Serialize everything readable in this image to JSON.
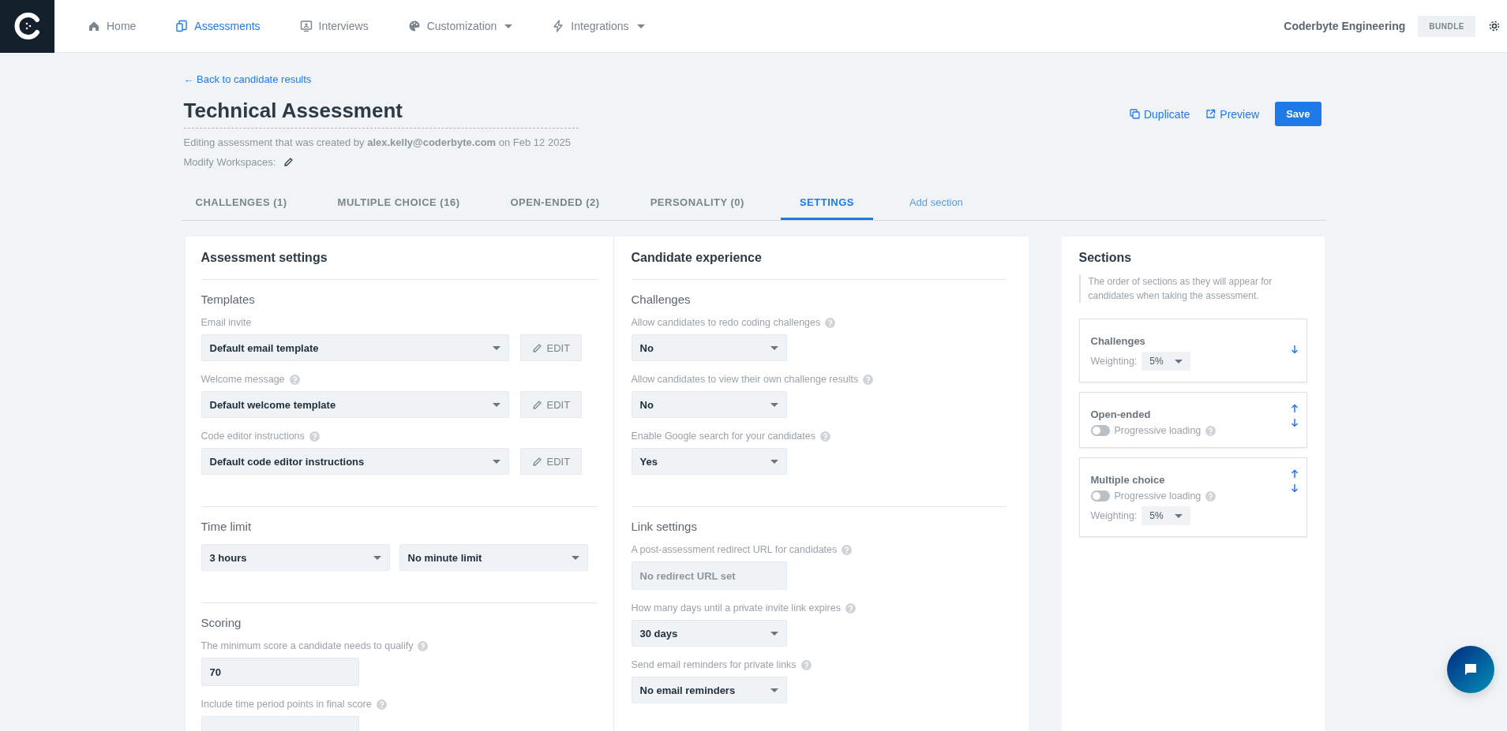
{
  "nav": {
    "items": [
      {
        "label": "Home",
        "selected": false,
        "dropdown": false
      },
      {
        "label": "Assessments",
        "selected": true,
        "dropdown": false
      },
      {
        "label": "Interviews",
        "selected": false,
        "dropdown": false
      },
      {
        "label": "Customization",
        "selected": false,
        "dropdown": true
      },
      {
        "label": "Integrations",
        "selected": false,
        "dropdown": true
      }
    ],
    "org": "Coderbyte Engineering",
    "plan": "BUNDLE"
  },
  "header": {
    "back_link": "← Back to candidate results",
    "title": "Technical Assessment",
    "meta": "Editing assessment that was created by **alex.kelly@coderbyte.com** on Feb 12 2025",
    "workspaces": "Modify Workspaces:",
    "actions": [
      {
        "kind": "duplicate",
        "label": "Duplicate"
      },
      {
        "kind": "preview",
        "label": "Preview"
      },
      {
        "kind": "primary",
        "label": "Save"
      }
    ]
  },
  "tabs": [
    {
      "kind": "section",
      "label": "CHALLENGES (1)",
      "selected": false
    },
    {
      "kind": "section",
      "label": "MULTIPLE CHOICE (16)",
      "selected": false
    },
    {
      "kind": "section",
      "label": "OPEN-ENDED (2)",
      "selected": false
    },
    {
      "kind": "section",
      "label": "PERSONALITY (0)",
      "selected": false
    },
    {
      "kind": "section",
      "label": "SETTINGS",
      "selected": true
    },
    {
      "kind": "add",
      "label": "Add section",
      "selected": false
    }
  ],
  "panels": [
    {
      "title": "Assessment settings",
      "groups": [
        {
          "kind": "stacked",
          "heading": "Templates",
          "fields": [
            {
              "kind": "select",
              "label": "Email invite",
              "help": false,
              "value": "Default email template",
              "edit": "EDIT"
            },
            {
              "kind": "select",
              "label": "Welcome message",
              "help": true,
              "value": "Default welcome template",
              "edit": "EDIT"
            },
            {
              "kind": "select",
              "label": "Code editor instructions",
              "help": true,
              "value": "Default code editor instructions",
              "edit": "EDIT"
            }
          ]
        },
        {
          "kind": "row",
          "heading": "Time limit",
          "fields": [
            {
              "kind": "select",
              "value": "3 hours"
            },
            {
              "kind": "select",
              "value": "No minute limit"
            }
          ]
        },
        {
          "kind": "stacked",
          "heading": "Scoring",
          "fields": [
            {
              "kind": "input",
              "label": "The minimum score a candidate needs to qualify",
              "help": true,
              "value": "70"
            },
            {
              "kind": "input",
              "label": "Include time period points in final score",
              "help": true
            }
          ]
        }
      ]
    },
    {
      "title": "Candidate experience",
      "groups": [
        {
          "kind": "stacked",
          "heading": "Challenges",
          "fields": [
            {
              "kind": "select",
              "label": "Allow candidates to redo coding challenges",
              "help": true,
              "value": "No"
            },
            {
              "kind": "select",
              "label": "Allow candidates to view their own challenge results",
              "help": true,
              "value": "No"
            },
            {
              "kind": "select",
              "label": "Enable Google search for your candidates",
              "help": true,
              "value": "Yes"
            }
          ]
        },
        {
          "kind": "stacked",
          "heading": "Link settings",
          "fields": [
            {
              "kind": "input",
              "label": "A post-assessment redirect URL for candidates",
              "help": true,
              "placeholder": "No redirect URL set"
            },
            {
              "kind": "select",
              "label": "How many days until a private invite link expires",
              "help": true,
              "value": "30 days"
            },
            {
              "kind": "select",
              "label": "Send email reminders for private links",
              "help": true,
              "value": "No email reminders"
            }
          ]
        }
      ]
    }
  ],
  "sections_panel": {
    "title": "Sections",
    "description": "The order of sections as they will appear for candidates when taking the assessment.",
    "cards": [
      {
        "title": "Challenges",
        "move_up": false,
        "move_down": true,
        "weighting": {
          "label": "Weighting:",
          "value": "5%"
        }
      },
      {
        "title": "Open-ended",
        "move_up": true,
        "move_down": true,
        "progressive": {
          "label": "Progressive loading",
          "on": false
        }
      },
      {
        "title": "Multiple choice",
        "move_up": true,
        "move_down": true,
        "progressive": {
          "label": "Progressive loading",
          "on": false
        },
        "weighting": {
          "label": "Weighting:",
          "value": "5%"
        }
      }
    ]
  }
}
